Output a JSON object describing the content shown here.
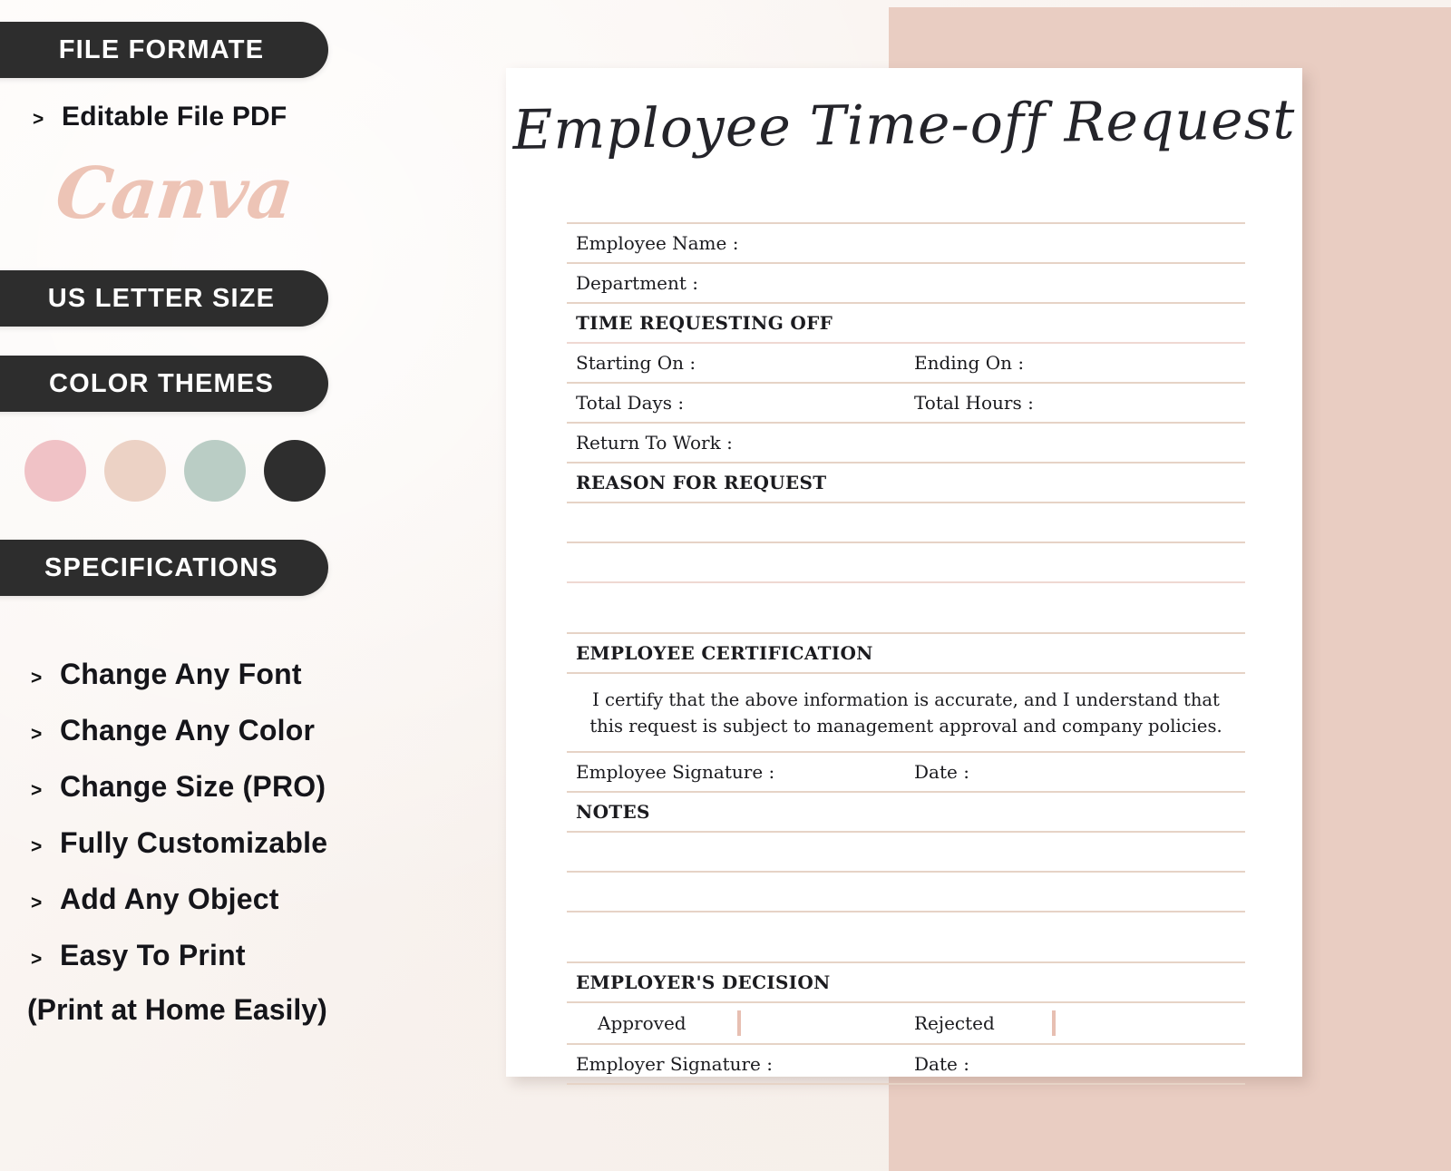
{
  "theme": {
    "pill_bg": "#2d2d2d",
    "pill_text": "#ffffff",
    "page_bg": "#fbf7f4",
    "pink_block": "#e9cdc2",
    "rule_color": "#e6d3c6",
    "checkbox_border": "#e7bfb2",
    "canva_color": "#edc4b6"
  },
  "sidebar": {
    "file_format": {
      "pill_label": "FILE FORMATE",
      "bullet_marker": ">",
      "item_label": "Editable File PDF",
      "brand_label": "Canva"
    },
    "size": {
      "pill_label": "US LETTER SIZE"
    },
    "color_themes": {
      "pill_label": "COLOR THEMES",
      "swatches": [
        {
          "name": "pink",
          "hex": "#f0c2c6"
        },
        {
          "name": "blush",
          "hex": "#ecd2c5"
        },
        {
          "name": "sage",
          "hex": "#bacdc5"
        },
        {
          "name": "charcoal",
          "hex": "#2e2e2e"
        }
      ]
    },
    "specifications": {
      "pill_label": "SPECIFICATIONS",
      "bullet_marker": ">",
      "items": [
        "Change Any Font",
        "Change Any Color",
        "Change Size (PRO)",
        "Fully Customizable",
        "Add Any Object",
        "Easy To Print"
      ],
      "footnote": "(Print at Home Easily)"
    }
  },
  "document": {
    "title": "Employee Time-off Request",
    "fields": {
      "employee_name": "Employee Name :",
      "department": "Department :",
      "starting_on": "Starting On :",
      "ending_on": "Ending On :",
      "total_days": "Total Days :",
      "total_hours": "Total Hours :",
      "return_to_work": "Return To Work :",
      "employee_signature": "Employee Signature :",
      "employee_date": "Date :",
      "employer_signature": "Employer Signature :",
      "employer_date": "Date :"
    },
    "sections": {
      "time_requesting_off": "TIME REQUESTING OFF",
      "reason_for_request": "REASON FOR REQUEST",
      "employee_certification": "EMPLOYEE CERTIFICATION",
      "notes": "NOTES",
      "employers_decision": "EMPLOYER'S DECISION"
    },
    "certification_text": "I certify that the above information is accurate, and I understand that this request is subject to management approval and company policies.",
    "decision": {
      "approved_label": "Approved",
      "rejected_label": "Rejected"
    }
  }
}
